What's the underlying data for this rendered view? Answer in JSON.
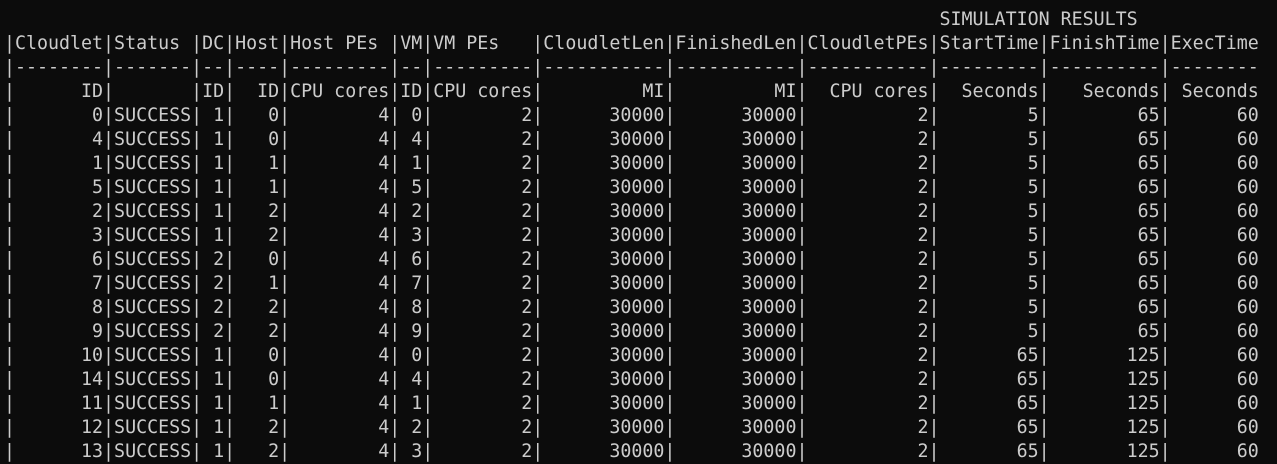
{
  "terminal": {
    "title_line": "                                                                                     SIMULATION RESULTS",
    "header_line": "|Cloudlet|Status |DC|Host|Host PEs |VM|VM PEs   |CloudletLen|FinishedLen|CloudletPEs|StartTime|FinishTime|ExecTime",
    "separator_line": "|--------|-------|--|----|---------|--|---------|-----------|-----------|-----------|---------|----------|--------",
    "units_line": "|      ID|       |ID|  ID|CPU cores|ID|CPU cores|         MI|         MI|  CPU cores|  Seconds|   Seconds| Seconds",
    "rows": [
      "|       0|SUCCESS| 1|   0|        4| 0|        2|      30000|      30000|          2|        5|        65|      60",
      "|       4|SUCCESS| 1|   0|        4| 4|        2|      30000|      30000|          2|        5|        65|      60",
      "|       1|SUCCESS| 1|   1|        4| 1|        2|      30000|      30000|          2|        5|        65|      60",
      "|       5|SUCCESS| 1|   1|        4| 5|        2|      30000|      30000|          2|        5|        65|      60",
      "|       2|SUCCESS| 1|   2|        4| 2|        2|      30000|      30000|          2|        5|        65|      60",
      "|       3|SUCCESS| 1|   2|        4| 3|        2|      30000|      30000|          2|        5|        65|      60",
      "|       6|SUCCESS| 2|   0|        4| 6|        2|      30000|      30000|          2|        5|        65|      60",
      "|       7|SUCCESS| 2|   1|        4| 7|        2|      30000|      30000|          2|        5|        65|      60",
      "|       8|SUCCESS| 2|   2|        4| 8|        2|      30000|      30000|          2|        5|        65|      60",
      "|       9|SUCCESS| 2|   2|        4| 9|        2|      30000|      30000|          2|        5|        65|      60",
      "|      10|SUCCESS| 1|   0|        4| 0|        2|      30000|      30000|          2|       65|       125|      60",
      "|      14|SUCCESS| 1|   0|        4| 4|        2|      30000|      30000|          2|       65|       125|      60",
      "|      11|SUCCESS| 1|   1|        4| 1|        2|      30000|      30000|          2|       65|       125|      60",
      "|      12|SUCCESS| 1|   2|        4| 2|        2|      30000|      30000|          2|       65|       125|      60",
      "|      13|SUCCESS| 1|   2|        4| 3|        2|      30000|      30000|          2|       65|       125|      60"
    ]
  }
}
